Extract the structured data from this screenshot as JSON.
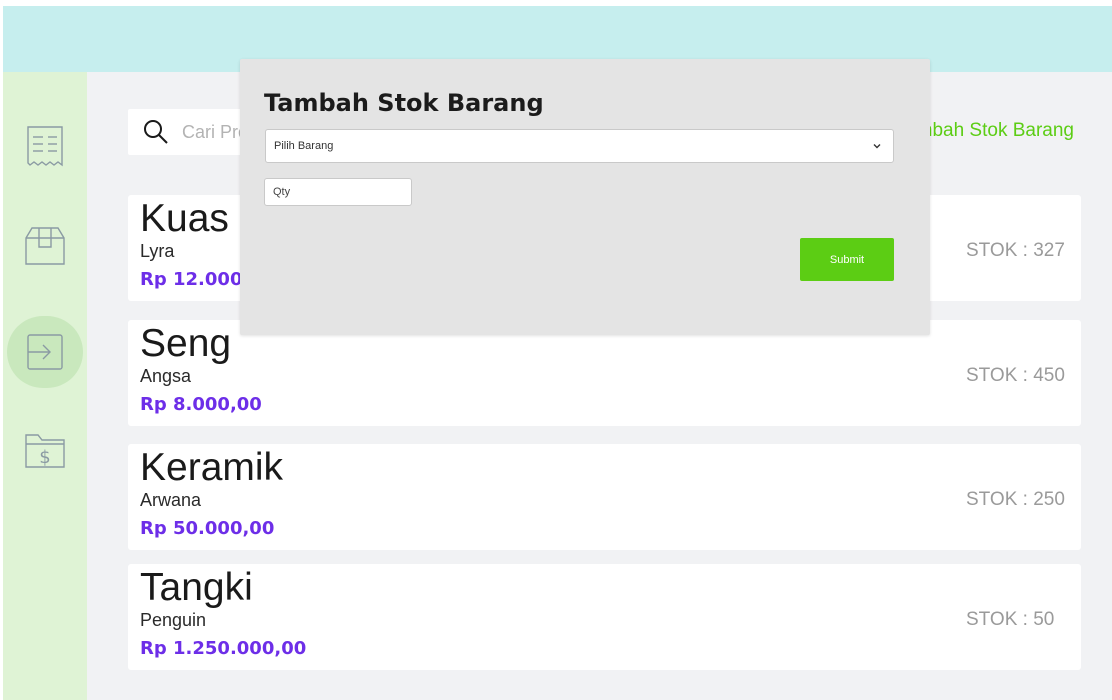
{
  "colors": {
    "topbar": "#c6eeee",
    "sidebar": "#dff3d5",
    "sidebar_active": "#c9e8bd",
    "accent_green": "#5ccd14",
    "price_purple": "#6d2ee8",
    "stock_gray": "#9a9a9a"
  },
  "sidebar": {
    "items": [
      {
        "icon": "receipt-icon",
        "active": false
      },
      {
        "icon": "box-icon",
        "active": false
      },
      {
        "icon": "stock-in-icon",
        "active": true
      },
      {
        "icon": "money-folder-icon",
        "active": false
      }
    ]
  },
  "search": {
    "placeholder": "Cari Produk",
    "icon": "search-icon"
  },
  "add_stock_link": "Tambah Stok Barang",
  "products": [
    {
      "name": "Kuas",
      "brand": "Lyra",
      "price": "Rp 12.000,00",
      "stock": "STOK : 327"
    },
    {
      "name": "Seng",
      "brand": "Angsa",
      "price": "Rp 8.000,00",
      "stock": "STOK : 450"
    },
    {
      "name": "Keramik",
      "brand": "Arwana",
      "price": "Rp 50.000,00",
      "stock": "STOK : 250"
    },
    {
      "name": "Tangki",
      "brand": "Penguin",
      "price": "Rp 1.250.000,00",
      "stock": "STOK : 50"
    }
  ],
  "modal": {
    "title": "Tambah Stok Barang",
    "select_value": "Pilih Barang",
    "qty_placeholder": "Qty",
    "submit_label": "Submit"
  }
}
